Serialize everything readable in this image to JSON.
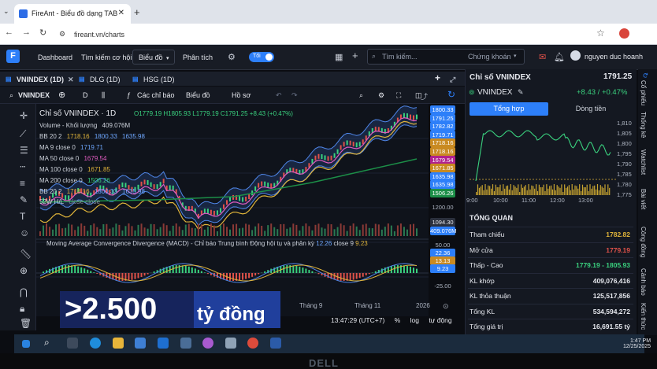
{
  "browser": {
    "tab_title": "FireAnt - Biểu đồ dạng TAB",
    "url": "fireant.vn/charts"
  },
  "header": {
    "menu": [
      "Dashboard",
      "Tìm kiếm cơ hội",
      "Biểu đồ",
      "Phân tích"
    ],
    "toggle_label": "Tối",
    "search_placeholder": "Tìm kiếm...",
    "market_select": "Chứng khoán",
    "user_name": "nguyen duc hoanh"
  },
  "chart_panel": {
    "tabs": [
      "VNINDEX (1D)",
      "DLG (1D)",
      "HSG (1D)"
    ],
    "toolbar": {
      "symbol": "VNINDEX",
      "interval": "D",
      "indicators": "Các chỉ báo",
      "chart_type": "Biểu đồ",
      "profile": "Hồ sơ"
    },
    "title": "Chỉ số VNINDEX · 1D",
    "ohlc": "O1779.19 H1805.93 L1779.19 C1791.25 +8.43 (+0.47%)",
    "legends": {
      "volume": "Volume - Khối lượng",
      "volume_value": "409.076M",
      "bb1": "BB 20 2",
      "bb1_values": [
        "1718.16",
        "1800.33",
        "1635.98"
      ],
      "ma9": "MA 9 close 0",
      "ma9_value": "1719.71",
      "ma50": "MA 50 close 0",
      "ma50_value": "1679.54",
      "ma100": "MA 100 close 0",
      "ma100_value": "1671.85",
      "ma200": "MA 200 close 0",
      "ma200_value": "1506.26",
      "bb2": "BB 20 2",
      "bb2_values": [
        "1718.16",
        "1800.33",
        "1635.98"
      ],
      "hl52": "52W H/L",
      "hl52_suffix": "close close"
    },
    "macd_label": "Moving Average Convergence Divergence (MACD) - Chỉ báo Trung bình Động hội tụ và phân kỳ",
    "macd_values": [
      "12.26",
      "close 9",
      "9.23"
    ],
    "right_axis": [
      {
        "v": "1800.33",
        "c": "#2d7ff9"
      },
      {
        "v": "1791.25",
        "c": "#2d7ff9"
      },
      {
        "v": "1782.82",
        "c": "#2d7ff9"
      },
      {
        "v": "1719.71",
        "c": "#2d7ff9"
      },
      {
        "v": "1718.16",
        "c": "#c98a21"
      },
      {
        "v": "1718.16",
        "c": "#c98a21"
      },
      {
        "v": "1679.54",
        "c": "#b1228f"
      },
      {
        "v": "1671.85",
        "c": "#c98a21"
      },
      {
        "v": "1635.98",
        "c": "#2d7ff9"
      },
      {
        "v": "1635.98",
        "c": "#2d7ff9"
      },
      {
        "v": "1506.26",
        "c": "#1c8f48"
      }
    ],
    "axis_labels": [
      "1200.00",
      "1094.30",
      "409.076M",
      "50.00",
      "22.36",
      "13.13",
      "9.23",
      "-25.00"
    ],
    "time_labels": [
      "Tháng 9",
      "Tháng 11",
      "2026"
    ],
    "bottom": {
      "time": "13:47:29 (UTC+7)",
      "percent": "%",
      "log": "log",
      "auto": "tự động"
    }
  },
  "banner": {
    "big": ">2.500",
    "small": "tỷ đồng"
  },
  "right_panel": {
    "title": "Chỉ số VNINDEX",
    "price": "1791.25",
    "symbol": "VNINDEX",
    "change": "+8.43 / +0.47%",
    "tabs": [
      "Tổng hợp",
      "Dòng tiền"
    ],
    "mini_y": [
      "1,810",
      "1,805",
      "1,800",
      "1,795",
      "1,790",
      "1,785",
      "1,780",
      "1,775"
    ],
    "mini_x": [
      "9:00",
      "10:00",
      "11:00",
      "12:00",
      "13:00"
    ],
    "overview_title": "TỔNG QUAN",
    "overview": [
      {
        "k": "Tham chiếu",
        "v": "1782.82",
        "c": "#e0b43a"
      },
      {
        "k": "Mở cửa",
        "v": "1779.19",
        "c": "#e0524a"
      },
      {
        "k": "Thấp - Cao",
        "v": "1779.19 - 1805.93",
        "c": "#3ad27f"
      },
      {
        "k": "KL khớp",
        "v": "409,076,416",
        "c": "#e6e8ee"
      },
      {
        "k": "KL thỏa thuận",
        "v": "125,517,856",
        "c": "#e6e8ee"
      },
      {
        "k": "Tổng KL",
        "v": "534,594,272",
        "c": "#e6e8ee"
      },
      {
        "k": "Tổng giá trị",
        "v": "16,691.55 tỷ",
        "c": "#e6e8ee"
      }
    ],
    "vtabs": [
      "Cổ phiếu",
      "Thống kê",
      "Watchlist",
      "Bài viết",
      "Công đồng",
      "Cảnh báo",
      "Kiến thức"
    ]
  },
  "taskbar": {
    "time": "1:47 PM",
    "date": "12/25/2025"
  },
  "monitor_brand": "DELL"
}
